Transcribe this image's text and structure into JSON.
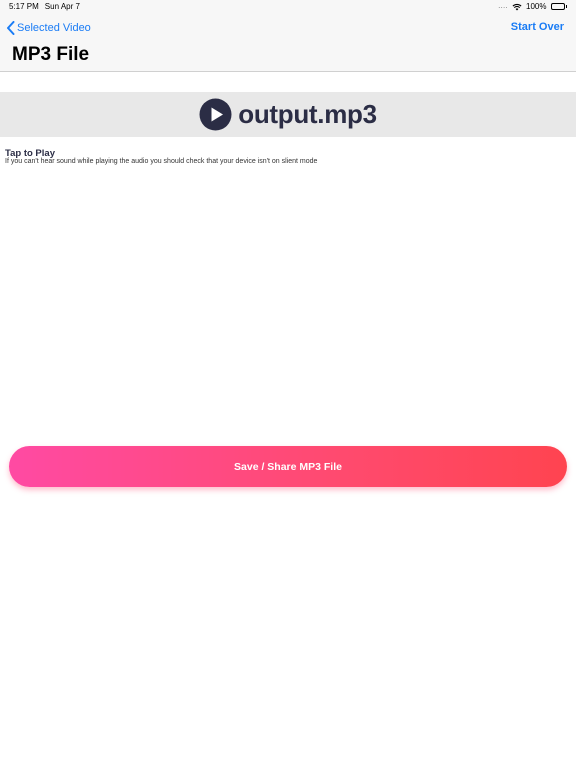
{
  "status_bar": {
    "time": "5:17 PM",
    "date": "Sun Apr 7",
    "signal": "....",
    "battery": "100%"
  },
  "nav": {
    "back_label": "Selected Video",
    "start_over_label": "Start Over",
    "title": "MP3 File"
  },
  "player": {
    "file_name": "output.mp3",
    "icon": "play-circle-icon"
  },
  "hint": {
    "title": "Tap to Play",
    "text": "If you can't hear sound while playing the audio you should check that your device isn't on slient mode"
  },
  "actions": {
    "save_label": "Save / Share MP3 File"
  },
  "colors": {
    "accent": "#1a7cf5",
    "player_text": "#2b2d45",
    "banner_bg": "#e8e8e8",
    "button_gradient_start": "#ff4aa3",
    "button_gradient_end": "#ff4450"
  }
}
